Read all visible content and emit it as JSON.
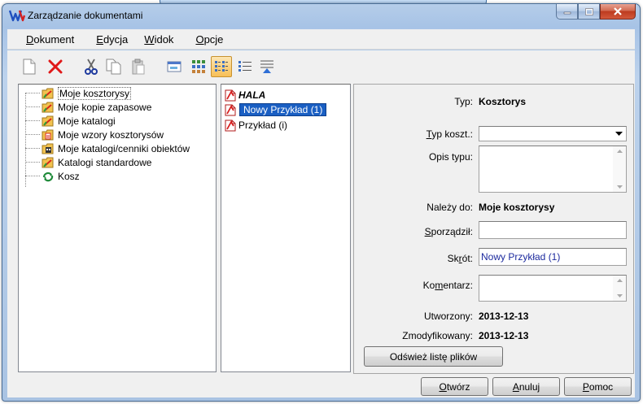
{
  "window": {
    "title": "Zarządzanie dokumentami"
  },
  "menu": {
    "items": [
      {
        "label": "Dokument",
        "accel": "D",
        "rest": "okument"
      },
      {
        "label": "Edycja",
        "accel": "E",
        "rest": "dycja"
      },
      {
        "label": "Widok",
        "accel": "W",
        "rest": "idok"
      },
      {
        "label": "Opcje",
        "accel": "O",
        "rest": "pcje"
      }
    ]
  },
  "toolbar": {
    "buttons": [
      "new-document-icon",
      "delete-icon",
      "cut-icon",
      "copy-icon",
      "paste-icon",
      "rename-icon",
      "large-icons-view-icon",
      "small-icons-view-icon",
      "list-view-icon",
      "details-view-icon"
    ],
    "active": "small-icons-view-icon"
  },
  "tree": {
    "items": [
      {
        "label": "Moje kosztorysy",
        "icon": "folder-estimates-icon"
      },
      {
        "label": "Moje kopie zapasowe",
        "icon": "folder-backups-icon"
      },
      {
        "label": "Moje katalogi",
        "icon": "folder-catalogs-icon"
      },
      {
        "label": "Moje wzory kosztorysów",
        "icon": "folder-templates-icon"
      },
      {
        "label": "Moje katalogi/cenniki obiektów",
        "icon": "folder-pricelists-icon"
      },
      {
        "label": "Katalogi standardowe",
        "icon": "folder-standard-catalogs-icon"
      },
      {
        "label": "Kosz",
        "icon": "recycle-bin-icon"
      }
    ],
    "selected": "Moje kosztorysy"
  },
  "files": {
    "items": [
      {
        "label": "HALA",
        "style": "bold"
      },
      {
        "label": "Nowy Przykład (1)",
        "style": "edit"
      },
      {
        "label": "Przykład (i)",
        "style": "normal"
      }
    ]
  },
  "details": {
    "type_label": "Typ:",
    "type_value": "Kosztorys",
    "estimate_type_label": {
      "accel": "T",
      "rest": "yp koszt.:"
    },
    "estimate_type_value": "",
    "type_description_label": "Opis typu:",
    "type_description_value": "",
    "belongs_label": "Należy do:",
    "belongs_value": "Moje kosztorysy",
    "author_label": {
      "accel": "S",
      "rest": "porządził:"
    },
    "author_value": "",
    "short_label": {
      "before": "Sk",
      "accel": "r",
      "after": "ót:"
    },
    "short_value": "Nowy Przykład (1)",
    "comment_label": {
      "before": "Ko",
      "accel": "m",
      "after": "entarz:"
    },
    "comment_value": "",
    "created_label": "Utworzony:",
    "created_value": "2013-12-13",
    "modified_label": "Zmodyfikowany:",
    "modified_value": "2013-12-13",
    "refresh_button": "Odśwież listę plików"
  },
  "footer": {
    "open": {
      "accel": "O",
      "rest": "twórz"
    },
    "cancel": {
      "accel": "A",
      "rest": "nuluj"
    },
    "help": {
      "accel": "P",
      "rest": "omoc"
    }
  },
  "colors": {
    "title_bar": "#a7c3e6",
    "close_button": "#c2442a",
    "active_tool": "#f7bf57",
    "edit_selection": "#1a5fc3",
    "field_text": "#1c2a9e"
  }
}
